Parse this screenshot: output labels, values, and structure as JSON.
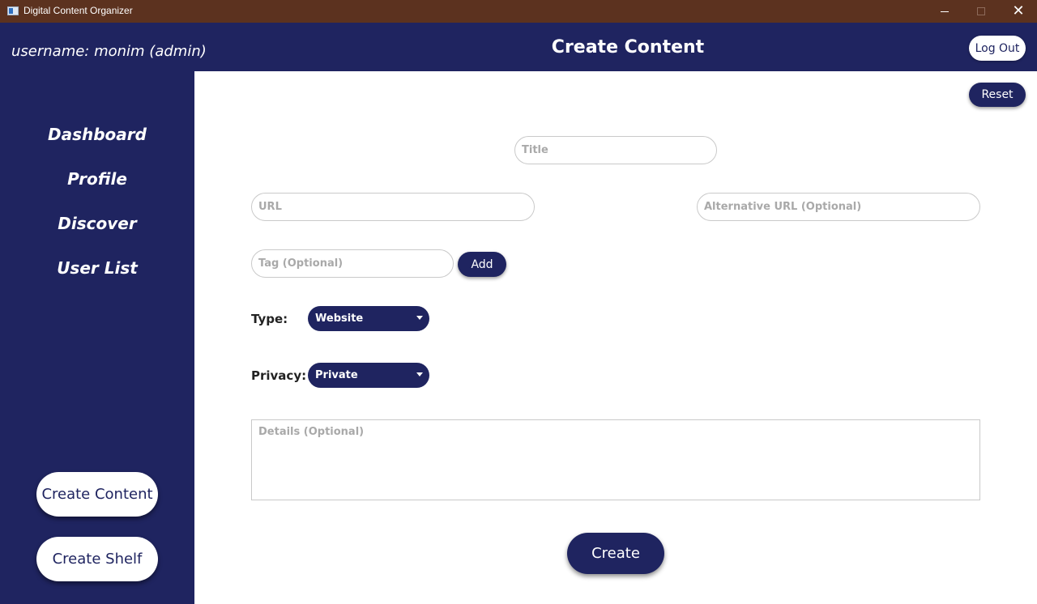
{
  "window": {
    "title": "Digital Content Organizer",
    "icon": "app-window-icon"
  },
  "header": {
    "username": "username: monim (admin)",
    "page_title": "Create Content",
    "logout_label": "Log Out"
  },
  "sidebar": {
    "nav": [
      {
        "label": "Dashboard"
      },
      {
        "label": "Profile"
      },
      {
        "label": "Discover"
      },
      {
        "label": "User List"
      }
    ],
    "create_content_label": "Create Content",
    "create_shelf_label": "Create Shelf"
  },
  "form": {
    "reset_label": "Reset",
    "title_placeholder": "Title",
    "url_placeholder": "URL",
    "alt_url_placeholder": "Alternative URL (Optional)",
    "tag_placeholder": "Tag (Optional)",
    "add_label": "Add",
    "type_label": "Type:",
    "type_value": "Website",
    "privacy_label": "Privacy:",
    "privacy_value": "Private",
    "details_placeholder": "Details (Optional)",
    "create_label": "Create"
  },
  "colors": {
    "titlebar": "#5c321f",
    "primary": "#1f2460",
    "background": "#ffffff",
    "placeholder": "#a9a9a9"
  }
}
